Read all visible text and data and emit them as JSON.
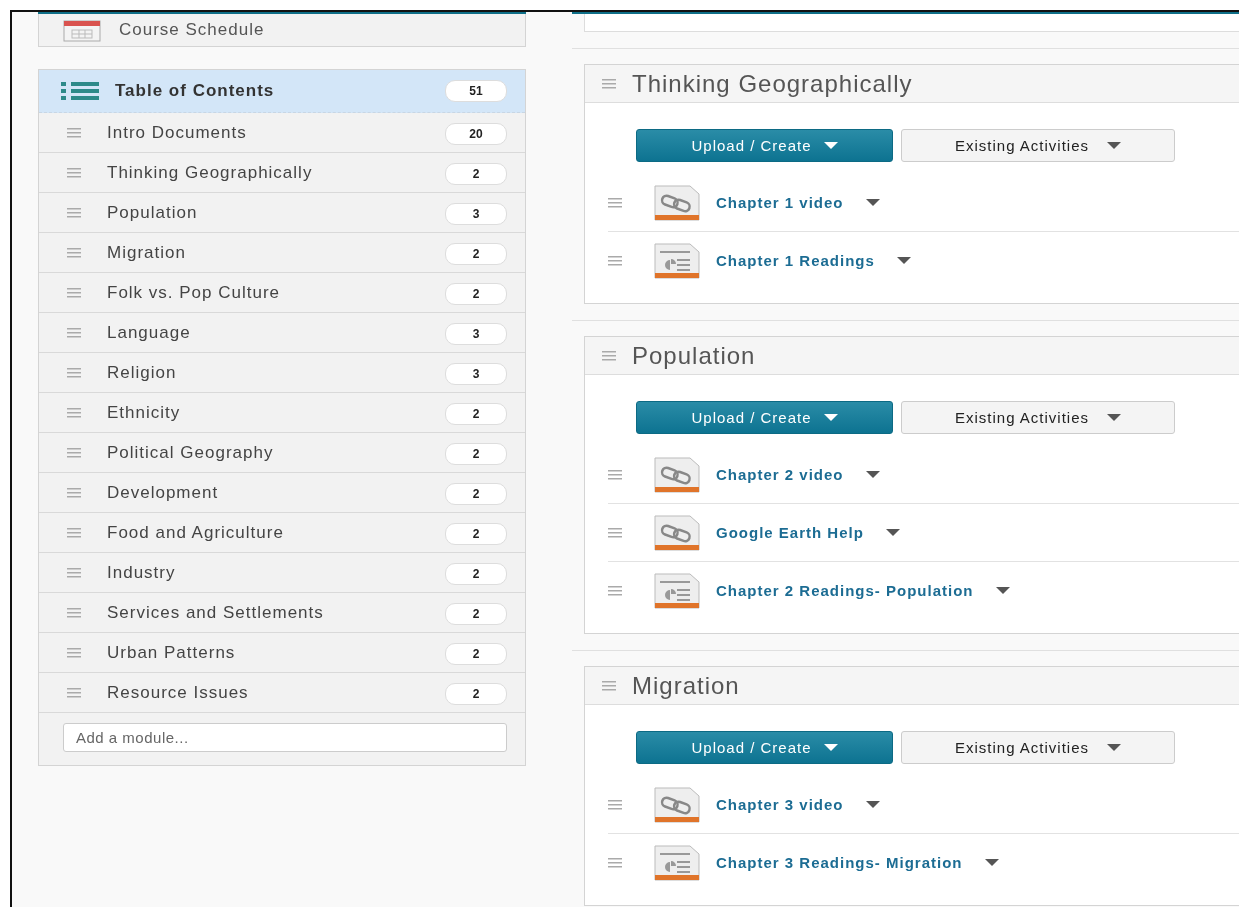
{
  "sidebar": {
    "schedule": {
      "label": "Course Schedule"
    },
    "toc": {
      "label": "Table of Contents",
      "count": "51",
      "selected": true
    },
    "modules": [
      {
        "label": "Intro Documents",
        "count": "20"
      },
      {
        "label": "Thinking Geographically",
        "count": "2"
      },
      {
        "label": "Population",
        "count": "3"
      },
      {
        "label": "Migration",
        "count": "2"
      },
      {
        "label": "Folk vs. Pop Culture",
        "count": "2"
      },
      {
        "label": "Language",
        "count": "3"
      },
      {
        "label": "Religion",
        "count": "3"
      },
      {
        "label": "Ethnicity",
        "count": "2"
      },
      {
        "label": "Political Geography",
        "count": "2"
      },
      {
        "label": "Development",
        "count": "2"
      },
      {
        "label": "Food and Agriculture",
        "count": "2"
      },
      {
        "label": "Industry",
        "count": "2"
      },
      {
        "label": "Services and Settlements",
        "count": "2"
      },
      {
        "label": "Urban Patterns",
        "count": "2"
      },
      {
        "label": "Resource Issues",
        "count": "2"
      }
    ],
    "add_module": {
      "placeholder": "Add a module..."
    }
  },
  "sections": [
    {
      "title": "Thinking Geographically",
      "upload_button": "Upload / Create",
      "existing_button": "Existing Activities",
      "items": [
        {
          "kind": "link",
          "title": "Chapter 1 video"
        },
        {
          "kind": "document",
          "title": "Chapter 1 Readings"
        }
      ]
    },
    {
      "title": "Population",
      "upload_button": "Upload / Create",
      "existing_button": "Existing Activities",
      "items": [
        {
          "kind": "link",
          "title": "Chapter 2 video"
        },
        {
          "kind": "link",
          "title": "Google Earth Help"
        },
        {
          "kind": "document",
          "title": "Chapter 2 Readings- Population"
        }
      ]
    },
    {
      "title": "Migration",
      "upload_button": "Upload / Create",
      "existing_button": "Existing Activities",
      "items": [
        {
          "kind": "link",
          "title": "Chapter 3 video"
        },
        {
          "kind": "document",
          "title": "Chapter 3 Readings- Migration"
        }
      ]
    }
  ]
}
